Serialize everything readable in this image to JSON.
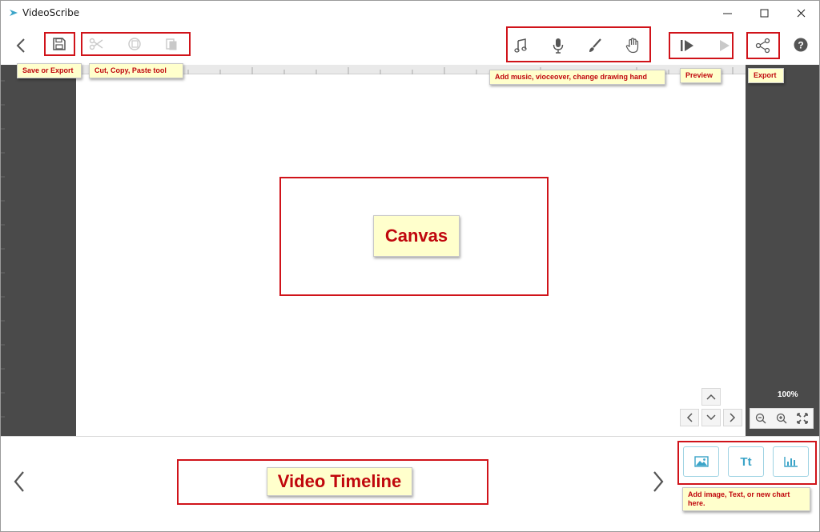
{
  "window": {
    "title": "VideoScribe",
    "minimize": "minimize",
    "maximize": "maximize",
    "close": "close"
  },
  "annotations": {
    "save_export": "Save or Export",
    "cut_copy_paste": "Cut, Copy, Paste tool",
    "add_music": "Add music, vioceover, change drawing hand",
    "preview": "Preview",
    "export": "Export",
    "canvas": "Canvas",
    "video_timeline": "Video Timeline",
    "add_content": "Add image, Text, or new chart here."
  },
  "canvas": {
    "zoom_level": "100%"
  },
  "timeline": {
    "add_text_label": "Tt"
  },
  "colors": {
    "annotation_red": "#d0131a",
    "note_bg": "#ffffcc",
    "side_panel": "#4a4a4a",
    "accent_blue": "#3ba4c8"
  },
  "icons": {
    "back": "chevron-left-icon",
    "save": "floppy-disk-icon",
    "cut": "scissors-icon",
    "copy": "copy-icon",
    "paste": "paste-icon",
    "music": "music-note-icon",
    "voiceover": "microphone-icon",
    "brush": "brush-icon",
    "hand": "hand-icon",
    "play_from": "play-from-icon",
    "play": "play-icon",
    "share": "share-icon",
    "help": "help-icon"
  }
}
